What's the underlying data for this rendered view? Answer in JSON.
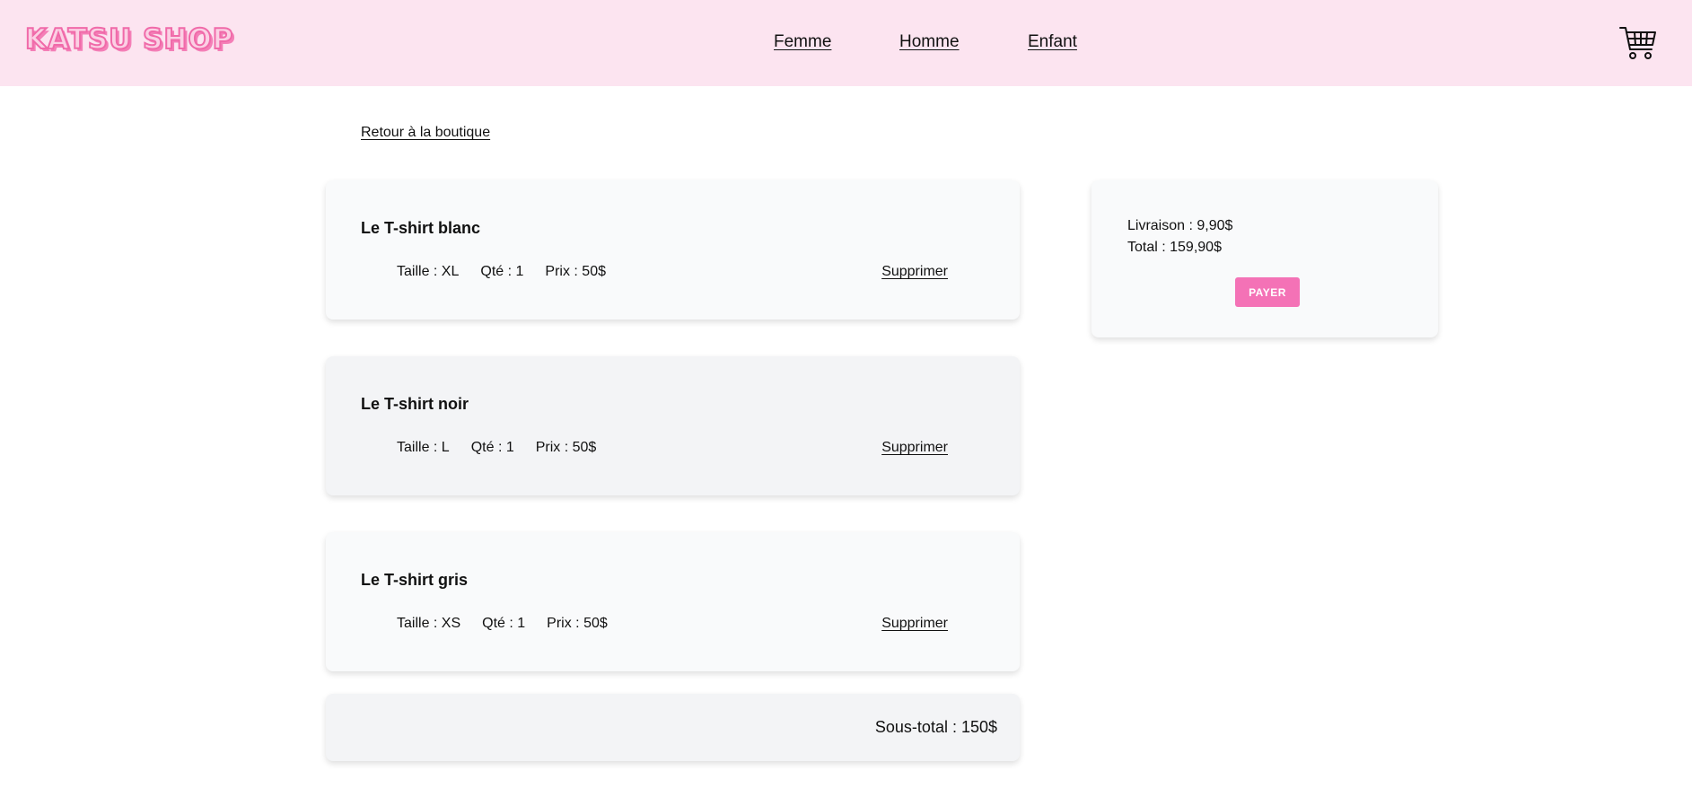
{
  "header": {
    "logo": "KATSU SHOP",
    "nav": [
      "Femme",
      "Homme",
      "Enfant"
    ],
    "cart_icon": "shopping-cart-icon"
  },
  "back_link": "Retour à la boutique",
  "cart": {
    "items": [
      {
        "name": "Le T-shirt blanc",
        "size": "Taille : XL",
        "qty": "Qté : 1",
        "price": "Prix : 50$",
        "delete": "Supprimer"
      },
      {
        "name": "Le T-shirt noir",
        "size": "Taille : L",
        "qty": "Qté : 1",
        "price": "Prix : 50$",
        "delete": "Supprimer"
      },
      {
        "name": "Le T-shirt gris",
        "size": "Taille : XS",
        "qty": "Qté : 1",
        "price": "Prix : 50$",
        "delete": "Supprimer"
      }
    ],
    "subtotal": "Sous-total : 150$"
  },
  "summary": {
    "shipping": "Livraison : 9,90$",
    "total": "Total : 159,90$",
    "pay_label": "PAYER"
  },
  "colors": {
    "header_bg": "#fce4f0",
    "accent": "#f472b6"
  }
}
